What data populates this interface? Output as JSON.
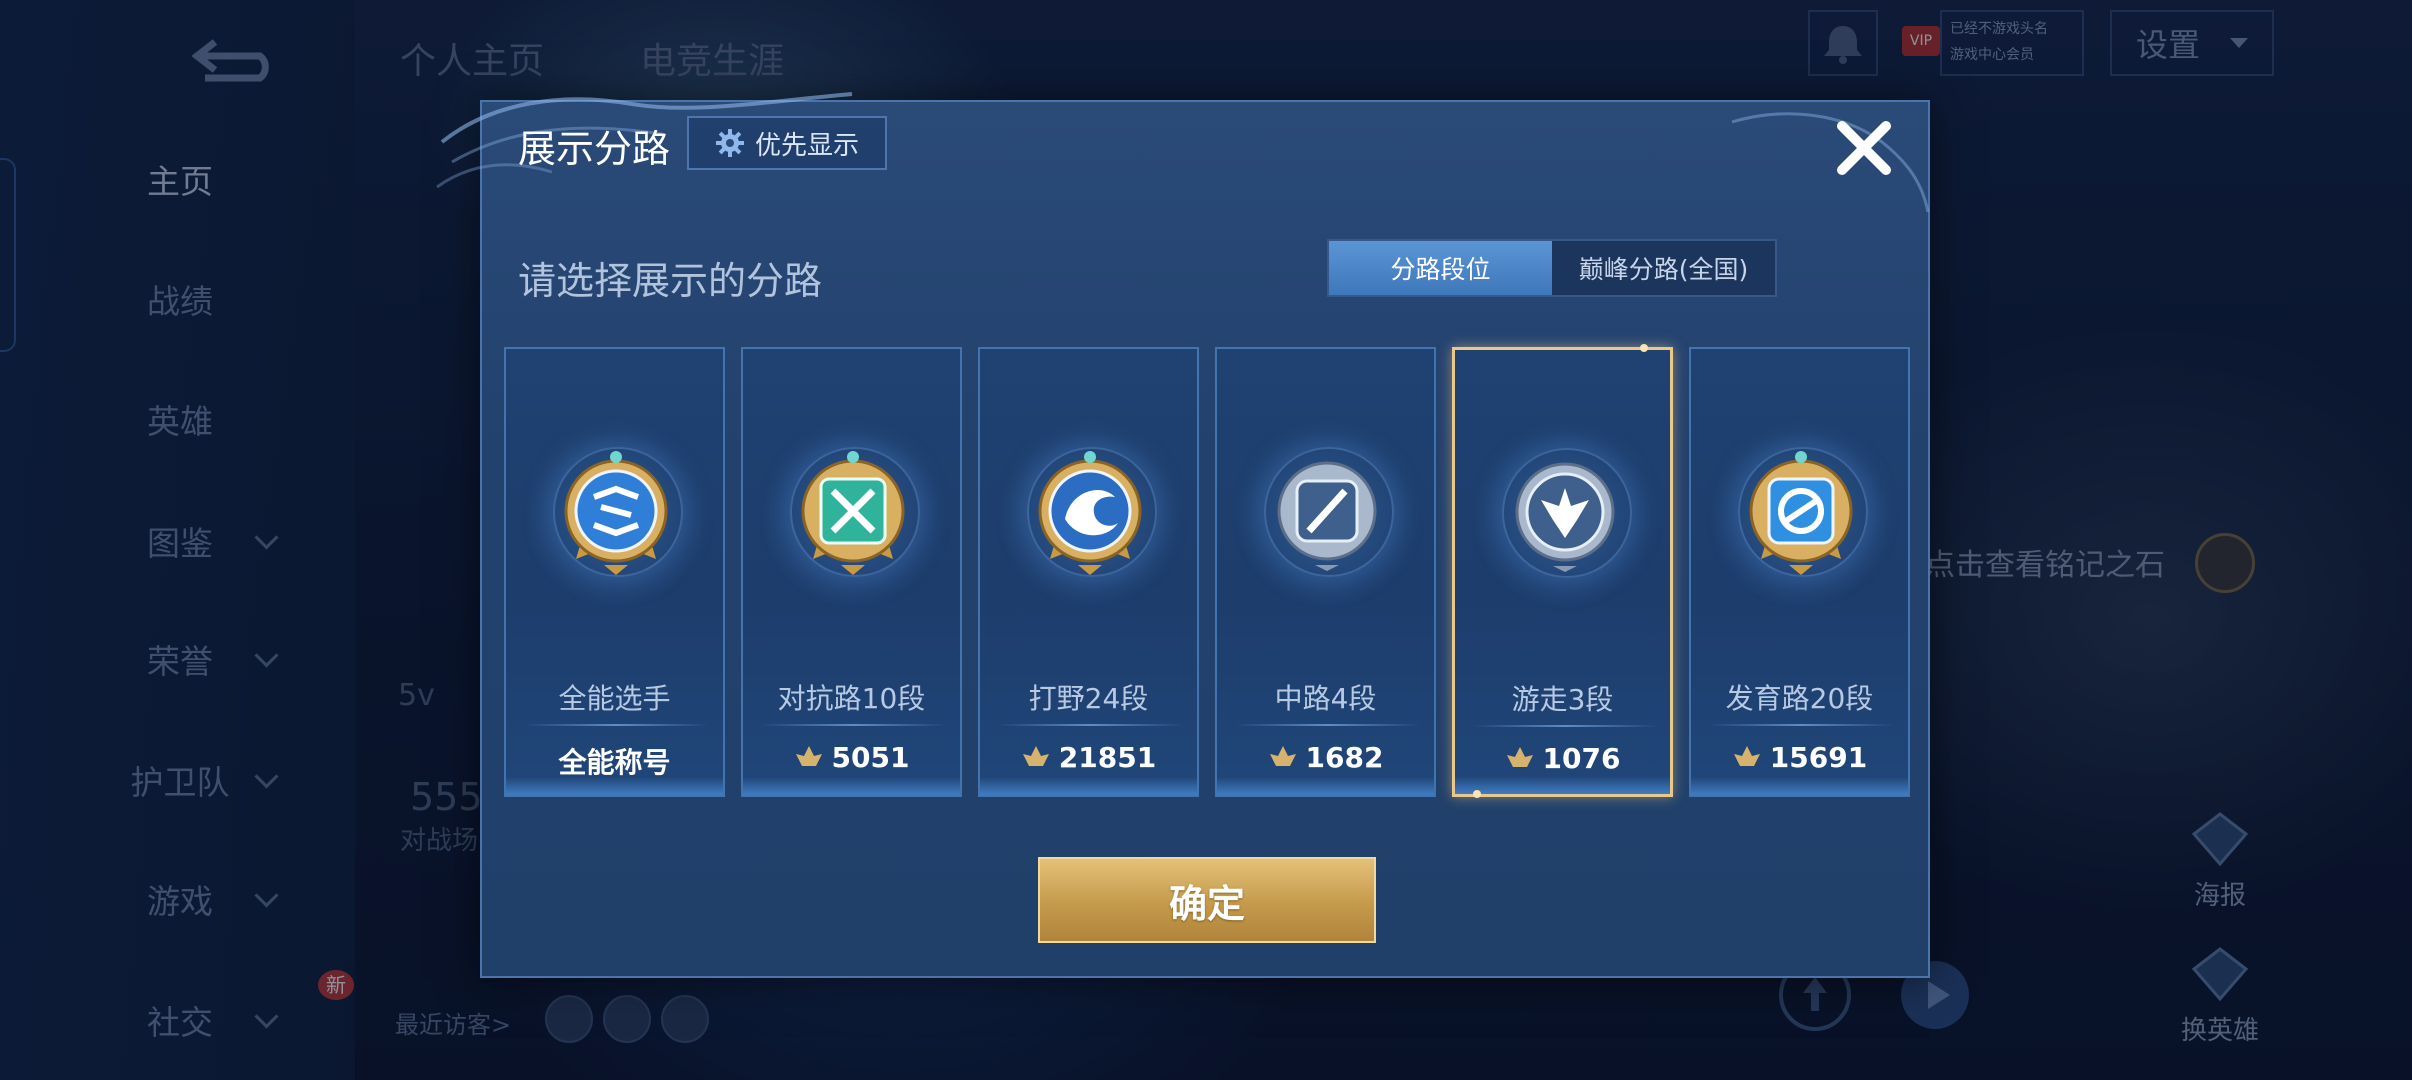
{
  "background": {
    "nav_items": [
      {
        "label": "主页",
        "active": true
      },
      {
        "label": "战绩"
      },
      {
        "label": "英雄"
      },
      {
        "label": "图鉴",
        "chevron": true
      },
      {
        "label": "荣誉",
        "chevron": true
      },
      {
        "label": "护卫队",
        "chevron": true
      },
      {
        "label": "游戏",
        "chevron": true
      },
      {
        "label": "社交",
        "chevron": true
      }
    ],
    "new_badge": "新",
    "top_tabs": [
      "个人主页",
      "电竞生涯"
    ],
    "settings_label": "设置",
    "vip_label": "VIP",
    "vip_line1": "已经不游戏头名",
    "vip_line2": "游戏中心会员",
    "inscription_text": "点击查看铭记之石",
    "poster_label": "海报",
    "change_hero_label": "换英雄",
    "recent_visitors": "最近访客>",
    "partial_texts": {
      "left_5v": "5v",
      "left_555": "555",
      "left_battle": "对战场"
    }
  },
  "modal": {
    "title": "展示分路",
    "priority_label": "优先显示",
    "subtitle": "请选择展示的分路",
    "toggle": {
      "options": [
        "分路段位",
        "巅峰分路(全国)"
      ],
      "selected": 0
    },
    "cards": [
      {
        "name": "全能选手",
        "value": "全能称号",
        "has_icon": false,
        "emblem": "all-round-emblem",
        "selected": false
      },
      {
        "name": "对抗路10段",
        "value": "5051",
        "has_icon": true,
        "emblem": "clash-lane-emblem",
        "selected": false
      },
      {
        "name": "打野24段",
        "value": "21851",
        "has_icon": true,
        "emblem": "jungle-emblem",
        "selected": false
      },
      {
        "name": "中路4段",
        "value": "1682",
        "has_icon": true,
        "emblem": "mid-lane-emblem",
        "selected": false
      },
      {
        "name": "游走3段",
        "value": "1076",
        "has_icon": true,
        "emblem": "roam-emblem",
        "selected": true
      },
      {
        "name": "发育路20段",
        "value": "15691",
        "has_icon": true,
        "emblem": "farm-lane-emblem",
        "selected": false
      }
    ],
    "confirm_label": "确定"
  },
  "colors": {
    "modal_bg": "#23416d",
    "accent_blue": "#4a86c8",
    "gold": "#d8b46a",
    "selected_border": "#e8c98a"
  }
}
